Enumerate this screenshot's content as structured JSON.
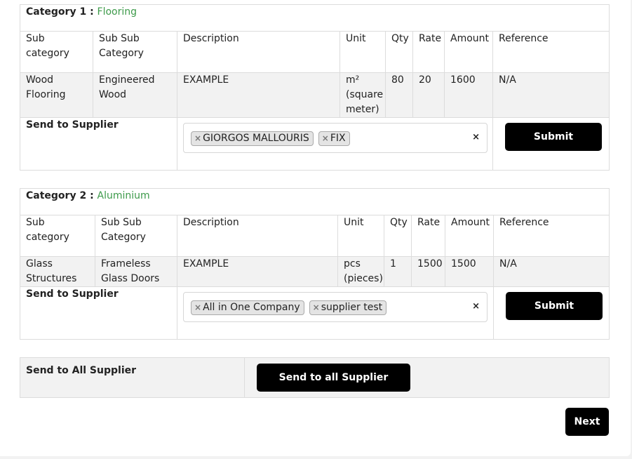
{
  "categories": [
    {
      "label": "Category 1 :",
      "name": "Flooring",
      "headers": [
        "Sub category",
        "Sub Sub Category",
        "Description",
        "Unit",
        "Qty",
        "Rate",
        "Amount",
        "Reference"
      ],
      "row": {
        "sub_category": "Wood Flooring",
        "sub_sub_category": "Engineered Wood",
        "description": "EXAMPLE",
        "unit": "m² (square meter)",
        "qty": "80",
        "rate": "20",
        "amount": "1600",
        "reference": "N/A"
      },
      "send_label": "Send to Supplier",
      "suppliers": [
        "GIORGOS MALLOURIS",
        "FIX"
      ],
      "submit_label": "Submit"
    },
    {
      "label": "Category 2 :",
      "name": "Aluminium",
      "headers": [
        "Sub category",
        "Sub Sub Category",
        "Description",
        "Unit",
        "Qty",
        "Rate",
        "Amount",
        "Reference"
      ],
      "row": {
        "sub_category": "Glass Structures",
        "sub_sub_category": "Frameless Glass Doors",
        "description": "EXAMPLE",
        "unit": "pcs (pieces)",
        "qty": "1",
        "rate": "1500",
        "amount": "1500",
        "reference": "N/A"
      },
      "send_label": "Send to Supplier",
      "suppliers": [
        "All in One Company",
        "supplier test"
      ],
      "submit_label": "Submit"
    }
  ],
  "send_all": {
    "label": "Send to All Supplier",
    "button_label": "Send to all Supplier"
  },
  "next_label": "Next",
  "icons": {
    "tag_remove": "×",
    "clear_all": "×"
  },
  "colors": {
    "category_name": "#3d9a4a",
    "button_bg": "#000000",
    "row_bg": "#f2f2f2"
  }
}
